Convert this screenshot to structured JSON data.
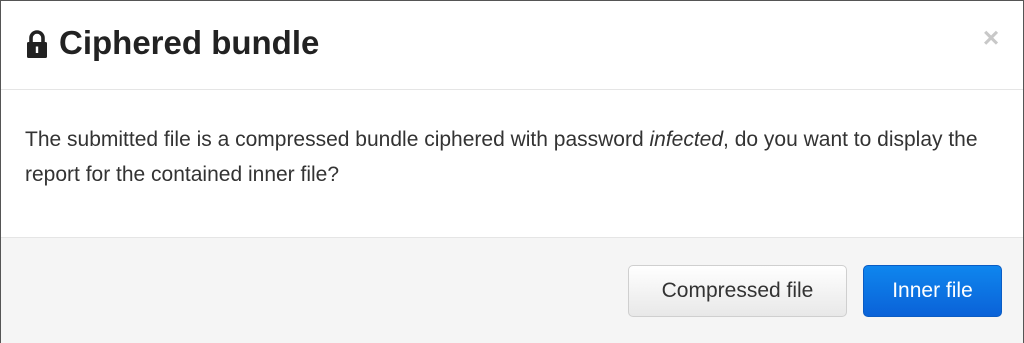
{
  "modal": {
    "title": "Ciphered bundle",
    "lock_icon": "lock-icon",
    "close_label": "×",
    "message_before": "The submitted file is a compressed bundle ciphered with password ",
    "password": "infected",
    "message_after": ", do you want to display the report for the contained inner file?"
  },
  "footer": {
    "compressed_label": "Compressed file",
    "inner_label": "Inner file"
  },
  "colors": {
    "title": "#222222",
    "body_text": "#333333",
    "footer_bg": "#f5f5f5",
    "primary": "#0a6fe0",
    "close": "#c8c8c8"
  }
}
